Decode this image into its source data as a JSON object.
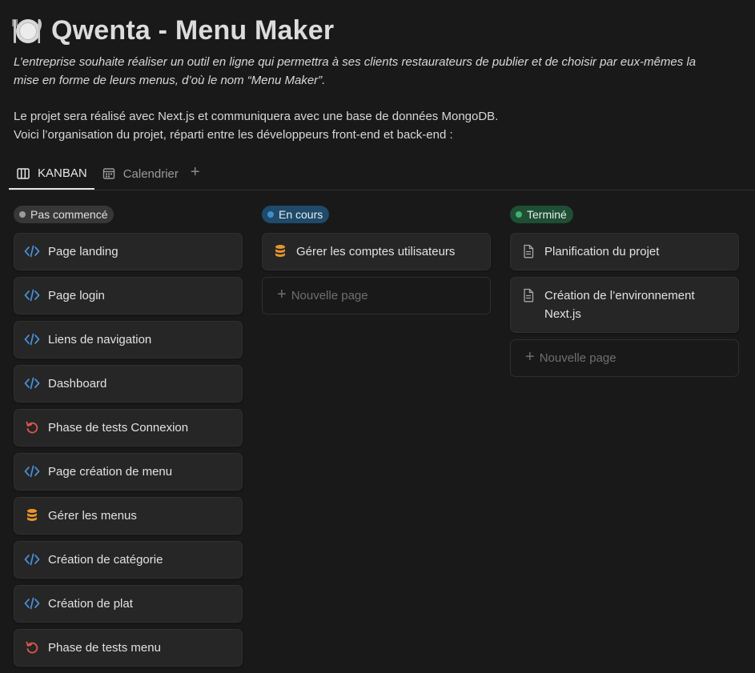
{
  "page": {
    "icon": "plate-cutlery-icon",
    "title": "Qwenta - Menu Maker",
    "intro": "L’entreprise souhaite réaliser un outil en ligne qui permettra à ses clients restaurateurs de publier et de choisir par eux-mêmes la mise en forme de leurs menus, d’où le nom “Menu Maker”.",
    "para1": "Le projet sera réalisé avec Next.js et communiquera avec une base de données MongoDB.",
    "para2": "Voici l’organisation du projet, réparti entre les développeurs front-end et back-end :"
  },
  "tabs": [
    {
      "label": "KANBAN",
      "icon": "board-icon",
      "active": true
    },
    {
      "label": "Calendrier",
      "icon": "calendar-icon",
      "active": false
    }
  ],
  "columns": [
    {
      "status": "Pas commencé",
      "color": "#9b9b9b",
      "cards": [
        {
          "title": "Page landing",
          "icon": "code-icon"
        },
        {
          "title": "Page login",
          "icon": "code-icon"
        },
        {
          "title": "Liens de navigation",
          "icon": "code-icon"
        },
        {
          "title": "Dashboard",
          "icon": "code-icon"
        },
        {
          "title": "Phase de tests Connexion",
          "icon": "retry-icon"
        },
        {
          "title": "Page création de menu",
          "icon": "code-icon"
        },
        {
          "title": "Gérer les menus",
          "icon": "database-icon"
        },
        {
          "title": "Création de catégorie",
          "icon": "code-icon"
        },
        {
          "title": "Création de plat",
          "icon": "code-icon"
        },
        {
          "title": "Phase de tests menu",
          "icon": "retry-icon"
        }
      ]
    },
    {
      "status": "En cours",
      "color": "#3d8fce",
      "cards": [
        {
          "title": "Gérer les comptes utilisateurs",
          "icon": "database-icon"
        }
      ],
      "new_page": "Nouvelle page"
    },
    {
      "status": "Terminé",
      "color": "#3fb26c",
      "cards": [
        {
          "title": "Planification du projet",
          "icon": "document-icon"
        },
        {
          "title": "Création de l’environnement Next.js",
          "icon": "document-icon"
        }
      ],
      "new_page": "Nouvelle page"
    }
  ]
}
